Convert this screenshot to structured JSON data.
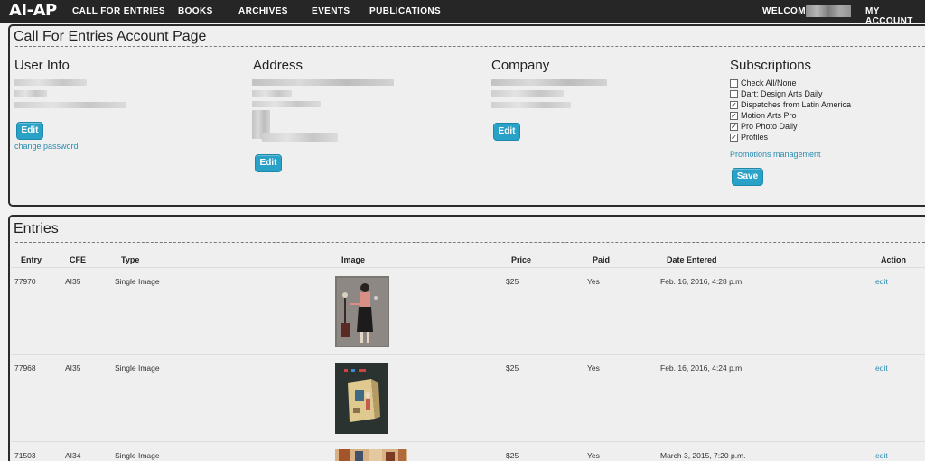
{
  "nav": {
    "logo": "AI-AP",
    "items": [
      "CALL FOR ENTRIES",
      "BOOKS",
      "ARCHIVES",
      "EVENTS",
      "PUBLICATIONS"
    ],
    "welcome": "WELCOME",
    "my_account": "MY ACCOUNT"
  },
  "account": {
    "title": "Call For Entries Account Page",
    "user_info": {
      "heading": "User Info",
      "edit": "Edit",
      "change_password": "change password"
    },
    "address": {
      "heading": "Address",
      "edit": "Edit"
    },
    "company": {
      "heading": "Company",
      "edit": "Edit"
    },
    "subscriptions": {
      "heading": "Subscriptions",
      "items": [
        {
          "label": "Check All/None",
          "checked": false
        },
        {
          "label": "Dart: Design Arts Daily",
          "checked": false
        },
        {
          "label": "Dispatches from Latin America",
          "checked": true
        },
        {
          "label": "Motion Arts Pro",
          "checked": true
        },
        {
          "label": "Pro Photo Daily",
          "checked": true
        },
        {
          "label": "Profiles",
          "checked": true
        }
      ],
      "promotions": "Promotions management",
      "save": "Save"
    }
  },
  "entries": {
    "title": "Entries",
    "columns": [
      "Entry",
      "CFE",
      "Type",
      "Image",
      "Price",
      "Paid",
      "Date Entered",
      "Action"
    ],
    "rows": [
      {
        "entry": "77970",
        "cfe": "AI35",
        "type": "Single Image",
        "price": "$25",
        "paid": "Yes",
        "date": "Feb. 16, 2016, 4:28 p.m.",
        "action": "edit"
      },
      {
        "entry": "77968",
        "cfe": "AI35",
        "type": "Single Image",
        "price": "$25",
        "paid": "Yes",
        "date": "Feb. 16, 2016, 4:24 p.m.",
        "action": "edit"
      },
      {
        "entry": "71503",
        "cfe": "AI34",
        "type": "Single Image",
        "price": "$25",
        "paid": "Yes",
        "date": "March 3, 2015, 7:20 p.m.",
        "action": "edit"
      }
    ]
  }
}
